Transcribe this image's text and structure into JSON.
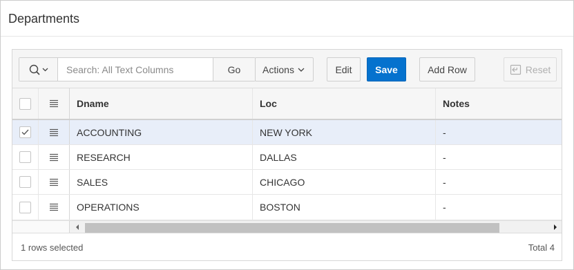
{
  "region": {
    "title": "Departments"
  },
  "toolbar": {
    "search_placeholder": "Search: All Text Columns",
    "go_label": "Go",
    "actions_label": "Actions",
    "edit_label": "Edit",
    "save_label": "Save",
    "add_row_label": "Add Row",
    "reset_label": "Reset"
  },
  "grid": {
    "columns": [
      "Dname",
      "Loc",
      "Notes"
    ],
    "rows": [
      {
        "dname": "ACCOUNTING",
        "loc": "NEW YORK",
        "notes": "-",
        "selected": true
      },
      {
        "dname": "RESEARCH",
        "loc": "DALLAS",
        "notes": "-",
        "selected": false
      },
      {
        "dname": "SALES",
        "loc": "CHICAGO",
        "notes": "-",
        "selected": false
      },
      {
        "dname": "OPERATIONS",
        "loc": "BOSTON",
        "notes": "-",
        "selected": false
      }
    ]
  },
  "footer": {
    "selection_text": "1 rows selected",
    "total_text": "Total 4"
  },
  "colors": {
    "save_button": "#0572ce",
    "selected_row": "#e8eef9"
  },
  "icons": {
    "search": "search-icon",
    "chevron": "chevron-down-icon",
    "row_actions": "hamburger-menu-icon",
    "reset": "reset-icon",
    "checkmark": "checkmark-icon"
  }
}
